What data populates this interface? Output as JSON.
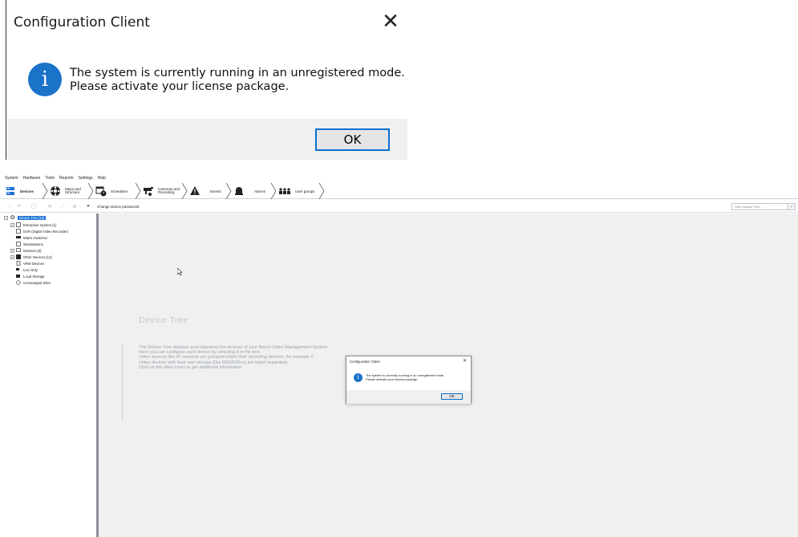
{
  "zoomed_dialog": {
    "title": "Configuration Client",
    "close_glyph": "✕",
    "message_line1": "The system is currently running in an unregistered mode.",
    "message_line2": "Please activate your license package.",
    "ok_label": "OK",
    "icon": "info-icon"
  },
  "menubar": {
    "items": [
      "System",
      "Hardware",
      "Tools",
      "Reports",
      "Settings",
      "Help"
    ]
  },
  "navbar": {
    "items": [
      {
        "label": "Devices",
        "icon": "devices-icon"
      },
      {
        "label": "Maps and\nStructure",
        "icon": "maps-icon"
      },
      {
        "label": "Schedules",
        "icon": "schedules-icon"
      },
      {
        "label": "Cameras and\nRecording",
        "icon": "cameras-icon"
      },
      {
        "label": "Events",
        "icon": "events-icon"
      },
      {
        "label": "Alarms",
        "icon": "alarms-icon"
      },
      {
        "label": "User groups",
        "icon": "user-groups-icon"
      }
    ]
  },
  "toolbar": {
    "change_passwords_label": "Change device passwords",
    "filter_placeholder": "Filter Device Tree..."
  },
  "tree": {
    "root": "Device Tree [10]",
    "items": [
      {
        "label": "Enterprise System [1]",
        "expandable": true
      },
      {
        "label": "DVR (Digital Video Recorder)",
        "expandable": false
      },
      {
        "label": "Matrix Switches",
        "expandable": false
      },
      {
        "label": "Workstations",
        "expandable": false
      },
      {
        "label": "Monitors [2]",
        "expandable": true
      },
      {
        "label": "Other Devices [12]",
        "expandable": true
      },
      {
        "label": "VRM Devices",
        "expandable": false
      },
      {
        "label": "Live Only",
        "expandable": false
      },
      {
        "label": "Local Storage",
        "expandable": false
      },
      {
        "label": "Unmanaged Sites",
        "expandable": false
      }
    ]
  },
  "content": {
    "title": "Device Tree",
    "lines": [
      "The Device Tree displays and organizes the devices of your Bosch Video Management System.",
      "Here you can configure each device by selecting it in the tree.",
      "Video sources like IP cameras are grouped under their recording devices, for example V",
      "Video devices with their own storage (like BRS/DiBos) are listed separately.",
      "Click on the other icons to get additional information."
    ]
  },
  "mini_dialog": {
    "title": "Configuration Client",
    "close_glyph": "✕",
    "message_line1": "The system is currently running in an unregistered mode.",
    "message_line2": "Please activate your license package.",
    "ok_label": "OK"
  },
  "colors": {
    "accent": "#1b73d6",
    "info_blue": "#1a72c9",
    "ok_border": "#0b6fd0",
    "content_bg": "#f0f0f0"
  }
}
